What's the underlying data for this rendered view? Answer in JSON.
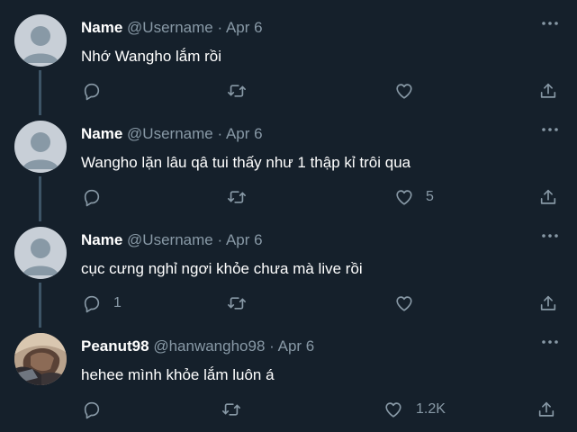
{
  "colors": {
    "background": "#15202b",
    "text": "#ffffff",
    "secondary": "#8899a6",
    "thread_line": "#3d5466",
    "avatar_default": "#c8cfd7"
  },
  "tweets": [
    {
      "name": "Name",
      "handle": "@Username",
      "separator": "·",
      "date": "Apr 6",
      "text": "Nhớ Wangho lắm rồi",
      "reply_count": "",
      "retweet_count": "",
      "like_count": "",
      "avatar": "default-avatar-icon"
    },
    {
      "name": "Name",
      "handle": "@Username",
      "separator": "·",
      "date": "Apr 6",
      "text": "Wangho lặn lâu qâ tui thấy như 1 thập kỉ trôi qua",
      "reply_count": "",
      "retweet_count": "",
      "like_count": "5",
      "avatar": "default-avatar-icon"
    },
    {
      "name": "Name",
      "handle": "@Username",
      "separator": "·",
      "date": "Apr 6",
      "text": "cục cưng nghỉ ngơi khỏe chưa mà live rồi",
      "reply_count": "1",
      "retweet_count": "",
      "like_count": "",
      "avatar": "default-avatar-icon"
    },
    {
      "name": "Peanut98",
      "handle": "@hanwangho98",
      "separator": "·",
      "date": "Apr 6",
      "text": "hehee mình khỏe lắm luôn á",
      "reply_count": "",
      "retweet_count": "",
      "like_count": "1.2K",
      "avatar": "profile-photo"
    }
  ],
  "icons": {
    "more": "more-dots-icon",
    "reply": "reply-icon",
    "retweet": "retweet-icon",
    "like": "heart-icon",
    "share": "share-icon"
  }
}
